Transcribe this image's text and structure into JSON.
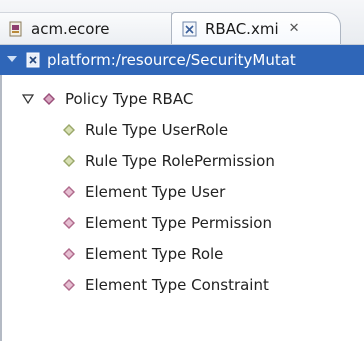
{
  "tabs": [
    {
      "label": "acm.ecore",
      "active": false
    },
    {
      "label": "RBAC.xmi",
      "active": true,
      "close_glyph": "✕"
    }
  ],
  "tree": {
    "root": {
      "label": "platform:/resource/SecurityMutat",
      "selected": true
    },
    "policy": {
      "label": "Policy Type RBAC"
    },
    "children": [
      {
        "label": "Rule Type UserRole",
        "kind": "rule"
      },
      {
        "label": "Rule Type RolePermission",
        "kind": "rule"
      },
      {
        "label": "Element Type User",
        "kind": "element"
      },
      {
        "label": "Element Type Permission",
        "kind": "element"
      },
      {
        "label": "Element Type Role",
        "kind": "element"
      },
      {
        "label": "Element Type Constraint",
        "kind": "element"
      }
    ]
  },
  "colors": {
    "selection": "#2f66b8",
    "rule_diamond": "#9aa86a",
    "element_diamond": "#b06a8c",
    "policy_diamond": "#9a4f7a"
  },
  "icons": {
    "ecore_tab": "ecore-file-icon",
    "xmi_tab": "xmi-file-icon",
    "expanded": "expanded-triangle-icon",
    "resource": "resource-icon",
    "node": "diamond-node-icon"
  }
}
